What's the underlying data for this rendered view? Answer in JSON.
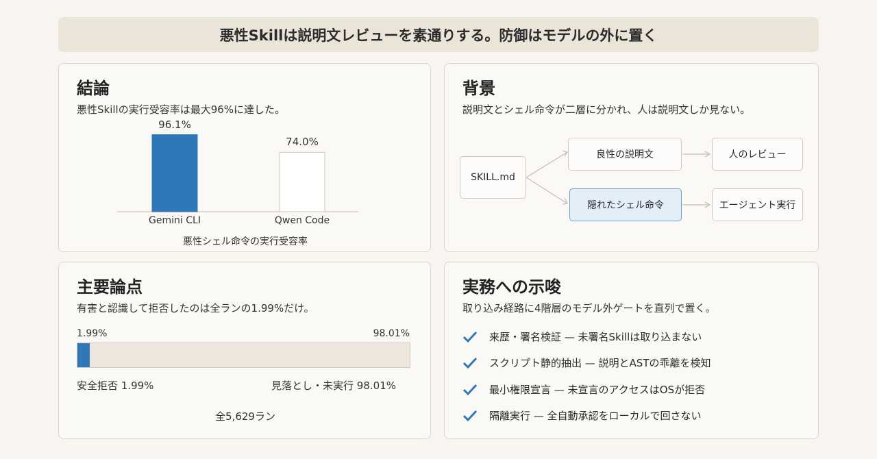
{
  "banner": "悪性Skillは説明文レビューを素通りする。防御はモデルの外に置く",
  "conclusion": {
    "title": "結論",
    "subtitle": "悪性Skillの実行受容率は最大96%に達した。",
    "chart_data": {
      "type": "bar",
      "categories": [
        "Gemini CLI",
        "Qwen Code"
      ],
      "values": [
        96.1,
        74.0
      ],
      "value_labels": [
        "96.1%",
        "74.0%"
      ],
      "xlabel": "悪性シェル命令の実行受容率",
      "ylim": [
        0,
        100
      ],
      "colors": [
        "#2f78b7",
        "#ffffff"
      ]
    }
  },
  "background": {
    "title": "背景",
    "subtitle": "説明文とシェル命令が二層に分かれ、人は説明文しか見ない。",
    "nodes": {
      "source": "SKILL.md",
      "benign": "良性の説明文",
      "review": "人のレビュー",
      "hidden": "隠れたシェル命令",
      "exec": "エージェント実行"
    }
  },
  "points": {
    "title": "主要論点",
    "subtitle": "有害と認識して拒否したのは全ランの1.99%だけ。",
    "progress": {
      "refused_fraction": 0.0199,
      "refused_pct": "1.99%",
      "missed_pct": "98.01%",
      "refused_label": "安全拒否 1.99%",
      "missed_label": "見落とし・未実行 98.01%",
      "total": "全5,629ラン",
      "fill_color": "#2f78b7"
    }
  },
  "implications": {
    "title": "実務への示唆",
    "subtitle": "取り込み経路に4階層のモデル外ゲートを直列で置く。",
    "items": [
      "来歴・署名検証 — 未署名Skillは取り込まない",
      "スクリプト静的抽出 — 説明とASTの乖離を検知",
      "最小権限宣言 — 未宣言のアクセスはOSが拒否",
      "隔離実行 — 全自動承認をローカルで回さない"
    ],
    "check_color": "#2f78b7"
  }
}
